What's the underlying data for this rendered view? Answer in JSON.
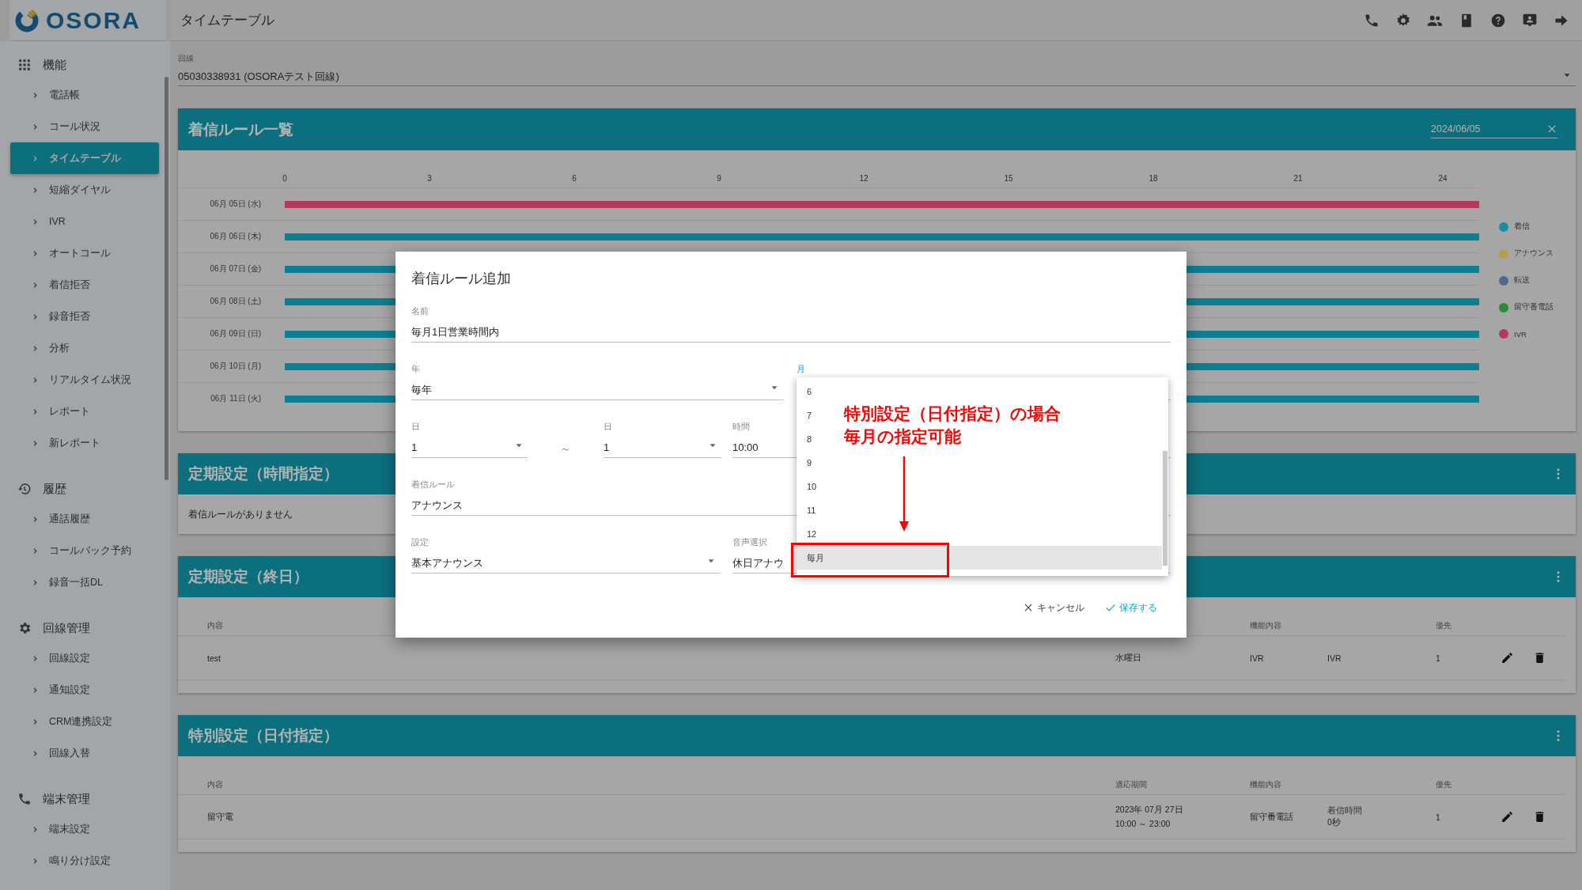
{
  "app": {
    "logo": "OSORA",
    "title": "タイムテーブル"
  },
  "sidebar": {
    "sections": [
      {
        "title": "機能",
        "kind": "apps",
        "items": [
          {
            "label": "電話帳",
            "selected": false
          },
          {
            "label": "コール状況",
            "selected": false
          },
          {
            "label": "タイムテーブル",
            "selected": true
          },
          {
            "label": "短縮ダイヤル",
            "selected": false
          },
          {
            "label": "IVR",
            "selected": false
          },
          {
            "label": "オートコール",
            "selected": false
          },
          {
            "label": "着信拒否",
            "selected": false
          },
          {
            "label": "録音拒否",
            "selected": false
          },
          {
            "label": "分析",
            "selected": false
          },
          {
            "label": "リアルタイム状況",
            "selected": false
          },
          {
            "label": "レポート",
            "selected": false
          },
          {
            "label": "新レポート",
            "selected": false
          }
        ]
      },
      {
        "title": "履歴",
        "kind": "history",
        "items": [
          {
            "label": "通話履歴",
            "selected": false
          },
          {
            "label": "コールバック予約",
            "selected": false
          },
          {
            "label": "録音一括DL",
            "selected": false
          }
        ]
      },
      {
        "title": "回線管理",
        "kind": "settings",
        "items": [
          {
            "label": "回線設定",
            "selected": false
          },
          {
            "label": "通知設定",
            "selected": false
          },
          {
            "label": "CRM連携設定",
            "selected": false
          },
          {
            "label": "回線入替",
            "selected": false
          }
        ]
      },
      {
        "title": "端末管理",
        "kind": "phone",
        "items": [
          {
            "label": "端末設定",
            "selected": false
          },
          {
            "label": "鳴り分け設定",
            "selected": false
          }
        ]
      }
    ]
  },
  "line_select": {
    "label": "回線",
    "value": "05030338931 (OSORAテスト回線)"
  },
  "timeline": {
    "title": "着信ルール一覧",
    "date": "2024/06/05",
    "hours": [
      "0",
      "3",
      "6",
      "9",
      "12",
      "15",
      "18",
      "21",
      "24"
    ],
    "rows": [
      {
        "date": "06月 05日 (水)",
        "color": "#b33a5a"
      },
      {
        "date": "06月 06日 (木)",
        "color": "#0e7f93"
      },
      {
        "date": "06月 07日 (金)",
        "color": "#0e7f93"
      },
      {
        "date": "06月 08日 (土)",
        "color": "#0e7f93"
      },
      {
        "date": "06月 09日 (日)",
        "color": "#0e7f93"
      },
      {
        "date": "06月 10日 (月)",
        "color": "#0e7f93"
      },
      {
        "date": "06月 11日 (火)",
        "color": "#0e7f93"
      }
    ],
    "legend": [
      {
        "label": "着信",
        "color": "#138fa6"
      },
      {
        "label": "アナウンス",
        "color": "#b3a04a"
      },
      {
        "label": "転送",
        "color": "#4d6a91"
      },
      {
        "label": "留守番電話",
        "color": "#2c8a3a"
      },
      {
        "label": "IVR",
        "color": "#b33a5a"
      }
    ]
  },
  "sections": [
    {
      "title": "定期設定（時間指定）",
      "empty_text": "着信ルールがありません"
    },
    {
      "title": "定期設定（終日）",
      "headers": {
        "content": "内容",
        "function": "機能内容",
        "priority": "優先"
      },
      "rows": [
        {
          "content": "test",
          "period": [
            "水曜日"
          ],
          "function": "IVR",
          "detail": {
            "value": "IVR"
          },
          "priority": "1"
        }
      ]
    },
    {
      "title": "特別設定（日付指定）",
      "headers": {
        "content": "内容",
        "period": "適応期間",
        "function": "機能内容",
        "priority": "優先"
      },
      "rows": [
        {
          "content": "留守電",
          "period": [
            "2023年 07月 27日",
            "10:00 ～ 23:00"
          ],
          "function": "留守番電話",
          "detail": {
            "label": "着信時間",
            "value": "0秒"
          },
          "priority": "1"
        }
      ]
    }
  ],
  "dialog": {
    "title": "着信ルール追加",
    "fields": [
      {
        "kind": "text",
        "label": "名前",
        "value": "毎月1日営業時間内",
        "focused": false
      },
      {
        "kind": "select",
        "label": "年",
        "value": "毎年",
        "focused": false
      },
      {
        "kind": "select",
        "label": "月",
        "focused": true
      },
      {
        "kind": "select",
        "label": "日",
        "value": "1",
        "focused": false
      },
      {
        "kind": "separator",
        "text": "～"
      },
      {
        "kind": "select",
        "label": "日",
        "value": "1",
        "focused": false
      },
      {
        "kind": "text",
        "label": "時間",
        "value": "10:00",
        "focused": false
      },
      {
        "kind": "text",
        "label": "着信ルール",
        "value": "アナウンス",
        "focused": false
      },
      {
        "kind": "select",
        "label": "設定",
        "value": "基本アナウンス",
        "focused": false
      },
      {
        "kind": "text",
        "label": "音声選択",
        "value": "休日アナウ",
        "focused": false
      }
    ],
    "buttons": [
      {
        "kind": "cancel",
        "label": "キャンセル"
      },
      {
        "kind": "save",
        "label": "保存する"
      }
    ],
    "month_menu": {
      "items": [
        {
          "label": "6",
          "selected": false
        },
        {
          "label": "7",
          "selected": false
        },
        {
          "label": "8",
          "selected": false
        },
        {
          "label": "9",
          "selected": false
        },
        {
          "label": "10",
          "selected": false
        },
        {
          "label": "11",
          "selected": false
        },
        {
          "label": "12",
          "selected": false
        },
        {
          "label": "毎月",
          "selected": true
        }
      ]
    }
  },
  "annotation": {
    "lines": [
      "特別設定（日付指定）の場合",
      "毎月の指定可能"
    ]
  }
}
